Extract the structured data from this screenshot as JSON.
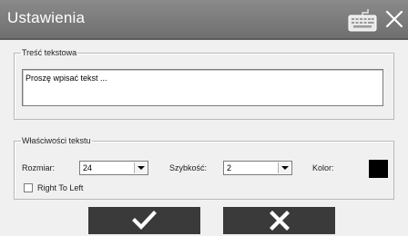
{
  "window": {
    "title": "Ustawienia",
    "icons": {
      "keyboard": "keyboard-icon",
      "close": "close-icon"
    }
  },
  "text_content": {
    "legend": "Treść tekstowa",
    "value": "Proszę wpisać tekst ..."
  },
  "text_properties": {
    "legend": "Właściwości tekstu",
    "size_label": "Rozmiar:",
    "size_value": "24",
    "speed_label": "Szybkość:",
    "speed_value": "2",
    "color_label": "Kolor:",
    "color_value": "#000000",
    "rtl_label": "Right To Left",
    "rtl_checked": false
  },
  "buttons": {
    "ok_icon": "checkmark-icon",
    "cancel_icon": "x-icon"
  },
  "colors": {
    "titlebar": "#7a7a7a",
    "button": "#3a3a3a",
    "background": "#f0f0f0"
  }
}
